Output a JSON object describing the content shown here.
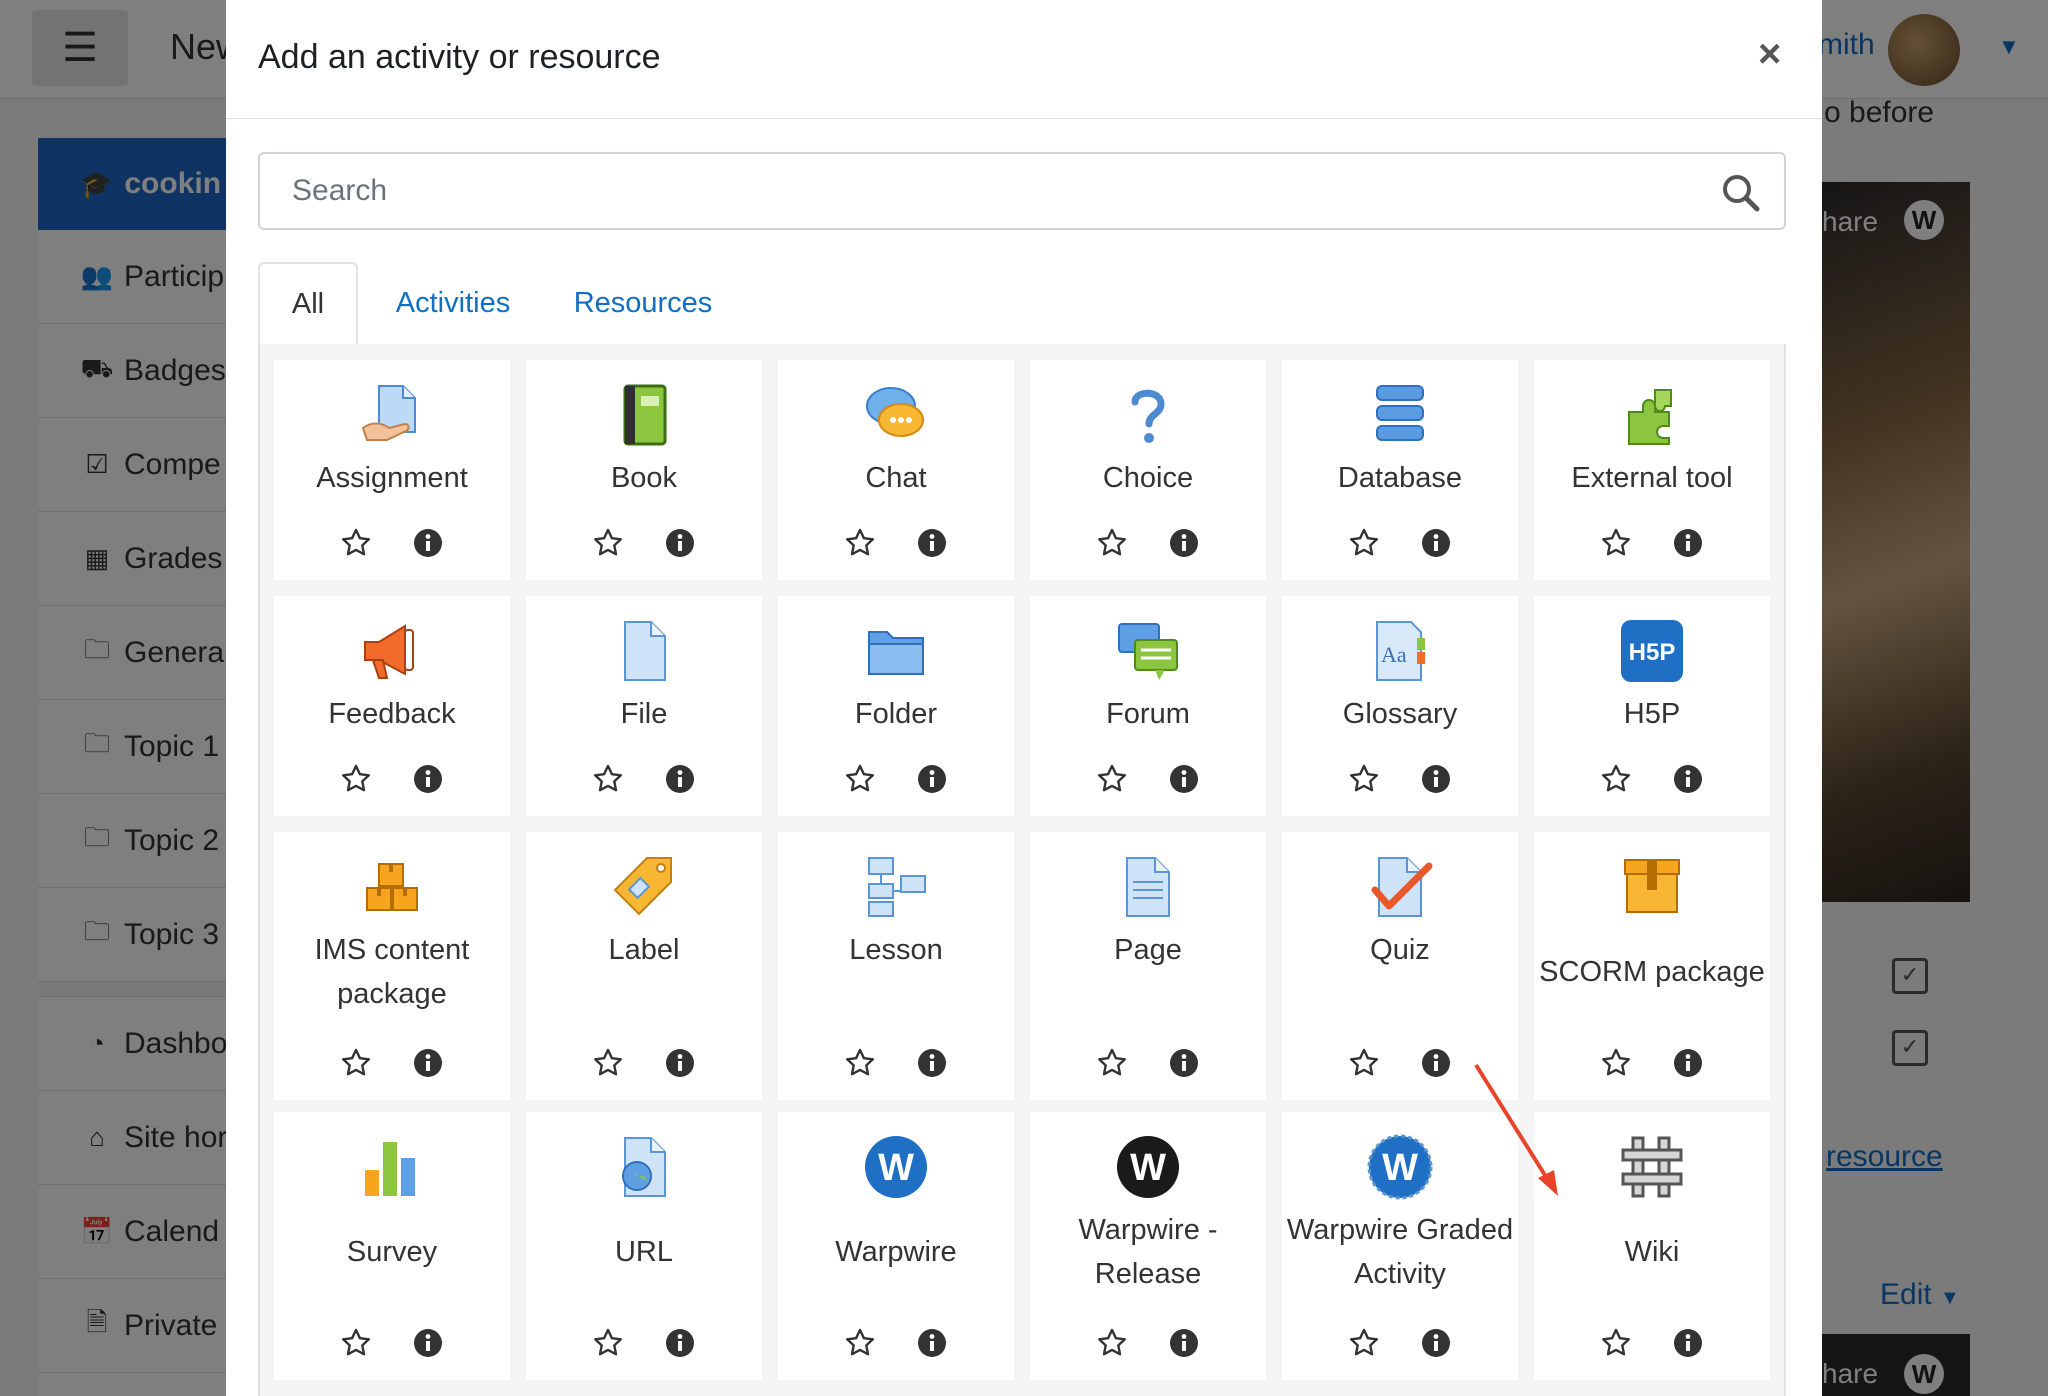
{
  "background": {
    "site_name": "New",
    "user_name": "mith",
    "course_label": "cookin",
    "drawer_items": [
      {
        "label": "Particip",
        "icon": "users-icon"
      },
      {
        "label": "Badges",
        "icon": "shield-icon"
      },
      {
        "label": "Compe",
        "icon": "checkbox-icon"
      },
      {
        "label": "Grades",
        "icon": "table-icon"
      },
      {
        "label": "Genera",
        "icon": "folder-icon"
      },
      {
        "label": "Topic 1",
        "icon": "folder-icon"
      },
      {
        "label": "Topic 2",
        "icon": "folder-icon"
      },
      {
        "label": "Topic 3",
        "icon": "folder-icon"
      }
    ],
    "drawer_items_2": [
      {
        "label": "Dashbo",
        "icon": "dashboard-icon"
      },
      {
        "label": "Site hor",
        "icon": "home-icon"
      },
      {
        "label": "Calend",
        "icon": "calendar-icon"
      },
      {
        "label": "Private",
        "icon": "file-icon"
      }
    ],
    "right_text": "o before",
    "share_text": "hare",
    "share_badge": "W",
    "resource_link": "resource",
    "edit_label": "Edit"
  },
  "modal": {
    "title": "Add an activity or resource",
    "close_glyph": "×",
    "search": {
      "placeholder": "Search"
    },
    "tabs": [
      {
        "label": "All",
        "active": true
      },
      {
        "label": "Activities",
        "active": false
      },
      {
        "label": "Resources",
        "active": false
      }
    ],
    "items": [
      {
        "label": "Assignment",
        "icon": "assignment-icon"
      },
      {
        "label": "Book",
        "icon": "book-icon"
      },
      {
        "label": "Chat",
        "icon": "chat-icon"
      },
      {
        "label": "Choice",
        "icon": "choice-icon"
      },
      {
        "label": "Database",
        "icon": "database-icon"
      },
      {
        "label": "External tool",
        "icon": "external-tool-icon"
      },
      {
        "label": "Feedback",
        "icon": "feedback-icon"
      },
      {
        "label": "File",
        "icon": "file-icon"
      },
      {
        "label": "Folder",
        "icon": "folder-icon"
      },
      {
        "label": "Forum",
        "icon": "forum-icon"
      },
      {
        "label": "Glossary",
        "icon": "glossary-icon"
      },
      {
        "label": "H5P",
        "icon": "h5p-icon",
        "icon_text": "H5P"
      },
      {
        "label": "IMS content package",
        "icon": "ims-package-icon"
      },
      {
        "label": "Label",
        "icon": "label-icon"
      },
      {
        "label": "Lesson",
        "icon": "lesson-icon"
      },
      {
        "label": "Page",
        "icon": "page-icon"
      },
      {
        "label": "Quiz",
        "icon": "quiz-icon"
      },
      {
        "label": "SCORM package",
        "icon": "scorm-icon"
      },
      {
        "label": "Survey",
        "icon": "survey-icon"
      },
      {
        "label": "URL",
        "icon": "url-icon"
      },
      {
        "label": "Warpwire",
        "icon": "warpwire-icon",
        "icon_text": "W"
      },
      {
        "label": "Warpwire - Release",
        "icon": "warpwire-release-icon",
        "icon_text": "W"
      },
      {
        "label": "Warpwire Graded Activity",
        "icon": "warpwire-graded-icon",
        "icon_text": "W"
      },
      {
        "label": "Wiki",
        "icon": "wiki-icon"
      }
    ]
  },
  "colors": {
    "link_blue": "#0f6fc5",
    "course_blue": "#1f66c4",
    "annotation_red": "#e8432b",
    "warpwire_blue": "#1f6fc4",
    "release_black": "#1a1a1a"
  }
}
